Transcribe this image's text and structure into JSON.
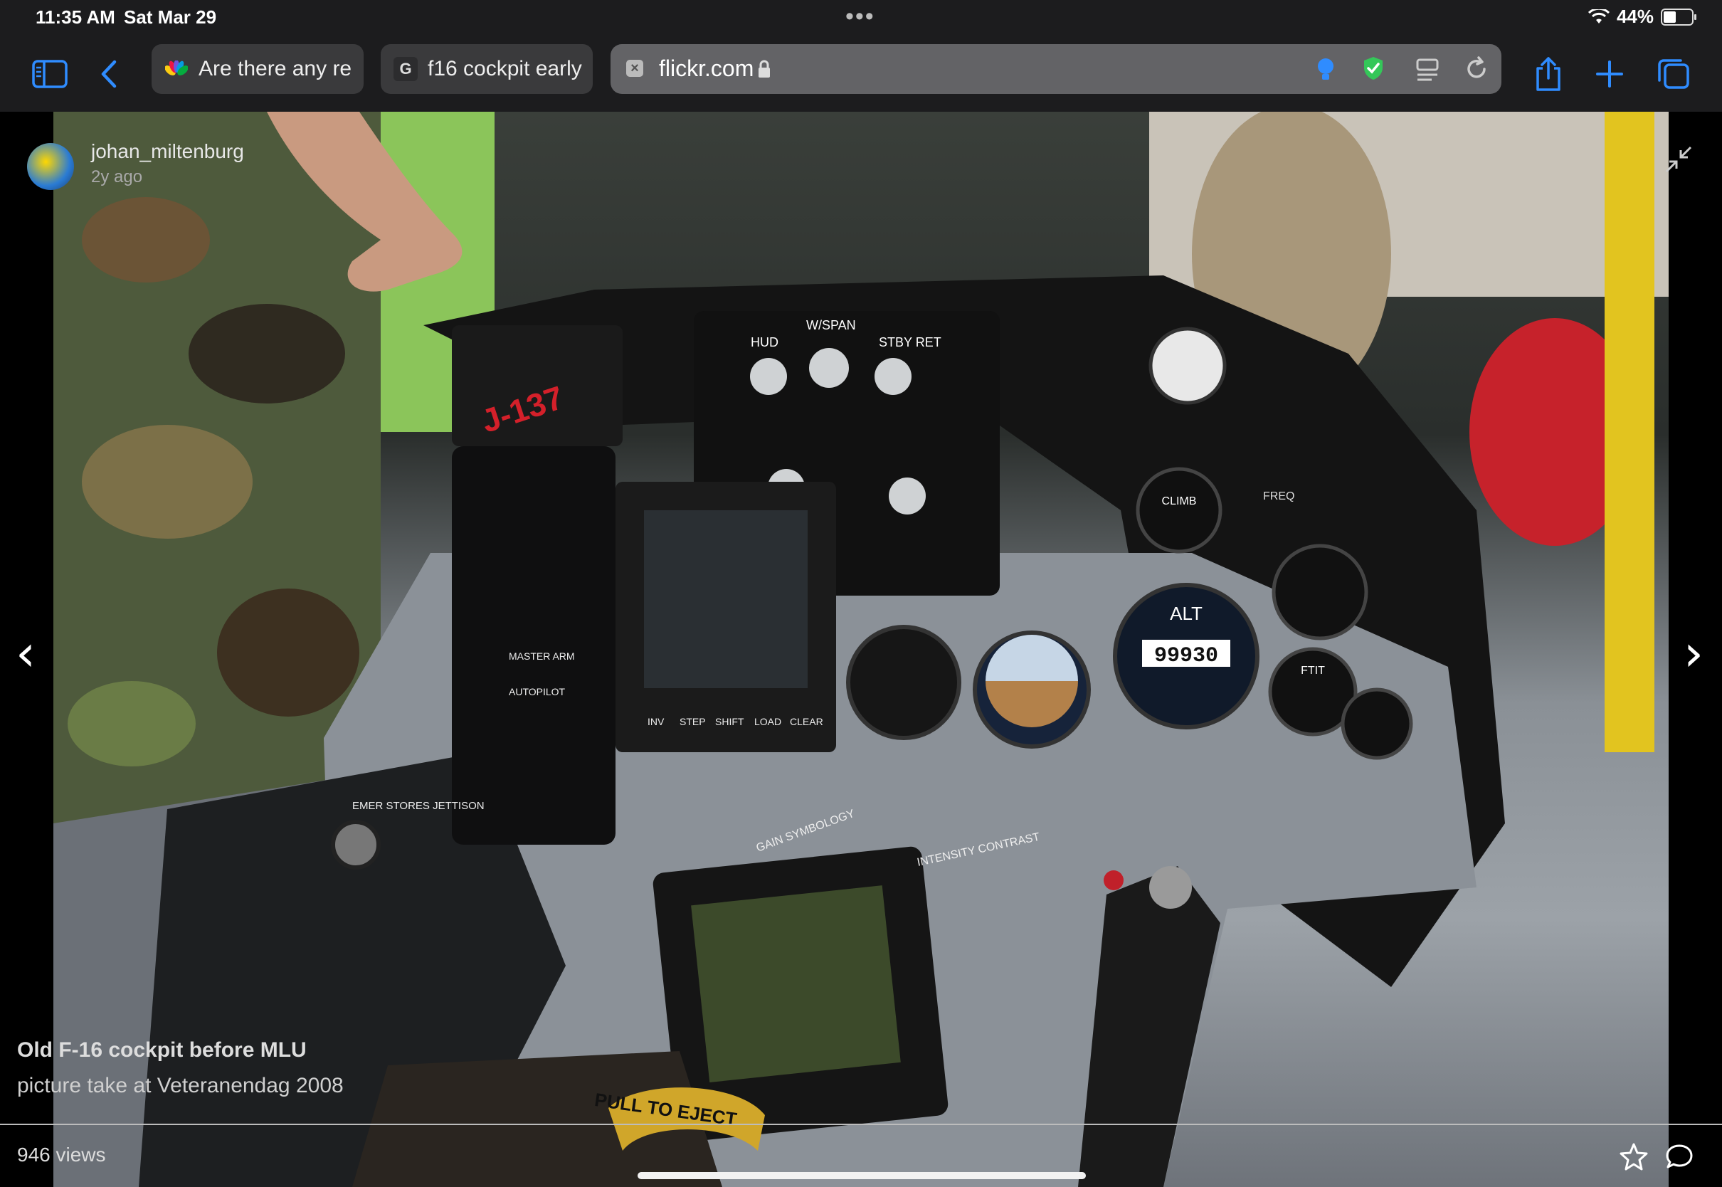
{
  "status_bar": {
    "time": "11:35 AM",
    "date": "Sat Mar 29",
    "more": "•••",
    "battery": "44%",
    "wifi_icon": "wifi-icon",
    "battery_level": 0.44
  },
  "toolbar": {
    "sidebar_icon": "sidebar-icon",
    "back_icon": "chevron-left-icon",
    "tabs": [
      {
        "label": "Are there any re",
        "icon": "nbc-peacock-icon"
      },
      {
        "label": "f16 cockpit early",
        "icon": "google-g-icon",
        "fav_text": "G"
      }
    ],
    "address": {
      "url": "flickr.com",
      "lock_icon": "lock-icon"
    },
    "tracker_icon": "lightbulb-icon",
    "shield_icon": "shield-check-icon",
    "reader_icon": "reader-icon",
    "reload_icon": "reload-icon",
    "share_icon": "share-icon",
    "new_tab_icon": "plus-icon",
    "tabs_icon": "tabs-overview-icon",
    "accent_color": "#2f8cff"
  },
  "photo": {
    "owner": "johan_miltenburg",
    "age": "2y ago",
    "title": "Old F-16 cockpit before MLU",
    "description": "picture take at Veteranendag 2008",
    "views": "946 views",
    "labels": {
      "eject": "PULL TO EJECT",
      "alt": "ALT",
      "alt_readout": "99930",
      "climb": "CLIMB",
      "ftit": "FTIT",
      "hud": "HUD",
      "wspan": "W/SPAN",
      "stby_ret": "STBY RET",
      "inv": "INV",
      "step": "STEP",
      "shift": "SHIFT",
      "load": "LOAD",
      "clear": "CLEAR",
      "placard": "J-137",
      "master_arm": "MASTER ARM",
      "autopilot": "AUTOPILOT",
      "emer_stores": "EMER STORES JETTISON",
      "gain_symbology": "GAIN SYMBOLOGY",
      "intensity": "INTENSITY CONTRAST",
      "freq": "FREQ"
    }
  }
}
